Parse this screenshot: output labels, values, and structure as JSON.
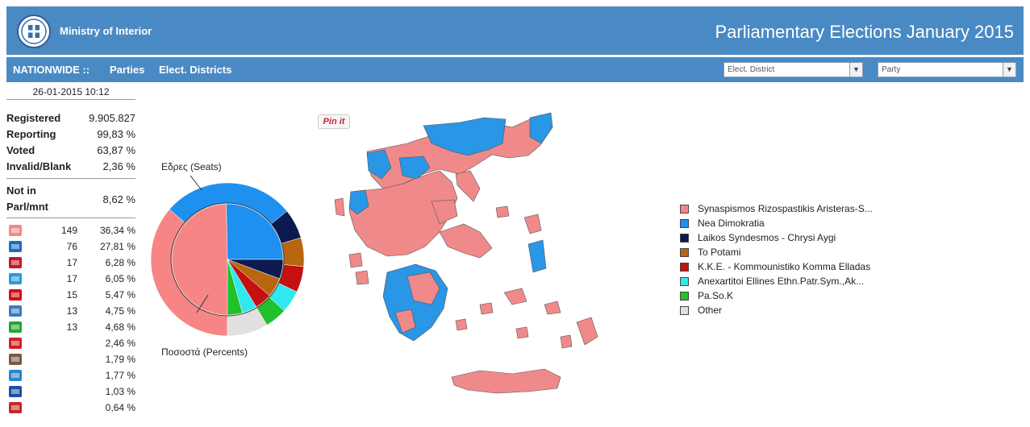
{
  "header": {
    "ministry": "Ministry of Interior",
    "title": "Parliamentary Elections January 2015",
    "logo_icon": "greek-emblem-icon"
  },
  "nav": {
    "nationwide": "NATIONWIDE ::",
    "parties": "Parties",
    "districts": "Elect. Districts",
    "district_select": "Elect. District",
    "party_select": "Party"
  },
  "stats": {
    "datetime": "26-01-2015 10:12",
    "registered_label": "Registered",
    "registered": "9.905.827",
    "reporting_label": "Reporting",
    "reporting": "99,83 %",
    "voted_label": "Voted",
    "voted": "63,87 %",
    "invalid_label": "Invalid/Blank",
    "invalid": "2,36 %",
    "notin_label": "Not in Parl/mnt",
    "notin": "8,62 %"
  },
  "parties": [
    {
      "icon": "syriza-logo-icon",
      "seats": "149",
      "pct": "36,34 %",
      "color": "#f08a8a"
    },
    {
      "icon": "nd-logo-icon",
      "seats": "76",
      "pct": "27,81 %",
      "color": "#1c6fb8"
    },
    {
      "icon": "golden-dawn-logo-icon",
      "seats": "17",
      "pct": "6,28 %",
      "color": "#c0182a"
    },
    {
      "icon": "potami-logo-icon",
      "seats": "17",
      "pct": "6,05 %",
      "color": "#2b9ad6"
    },
    {
      "icon": "kke-logo-icon",
      "seats": "15",
      "pct": "5,47 %",
      "color": "#d1121b"
    },
    {
      "icon": "anel-logo-icon",
      "seats": "13",
      "pct": "4,75 %",
      "color": "#3a7cc7"
    },
    {
      "icon": "pasok-logo-icon",
      "seats": "13",
      "pct": "4,68 %",
      "color": "#27a535"
    },
    {
      "icon": "kidiso-logo-icon",
      "seats": "",
      "pct": "2,46 %",
      "color": "#d42025"
    },
    {
      "icon": "leader-portrait-icon",
      "seats": "",
      "pct": "1,79 %",
      "color": "#7a5a45"
    },
    {
      "icon": "teleia-logo-icon",
      "seats": "",
      "pct": "1,77 %",
      "color": "#2b86c8"
    },
    {
      "icon": "anarsya-logo-icon",
      "seats": "",
      "pct": "1,03 %",
      "color": "#1f4fa0"
    },
    {
      "icon": "party-map-logo-icon",
      "seats": "",
      "pct": "0,64 %",
      "color": "#c62828"
    }
  ],
  "pinit": "Pin it",
  "chart_data": {
    "type": "pie",
    "seats_label": "Εδρες (Seats)",
    "percents_label": "Ποσοστά (Percents)",
    "categories": [
      "Synaspismos Rizospastikis Aristeras-S...",
      "Nea Dimokratia",
      "Laikos Syndesmos - Chrysi Aygi",
      "To Potami",
      "K.K.E. - Kommounistiko Komma Elladas",
      "Anexartitoi Ellines Ethn.Patr.Sym.,Ak...",
      "Pa.So.K",
      "Other"
    ],
    "colors": [
      "#f88585",
      "#1e90f0",
      "#0b1a4f",
      "#b8660f",
      "#c41010",
      "#30e8f0",
      "#22c02a",
      "#e0e0e0"
    ],
    "seats": [
      149,
      76,
      17,
      17,
      15,
      13,
      13,
      0
    ],
    "percents": [
      36.34,
      27.81,
      6.28,
      6.05,
      5.47,
      4.75,
      4.68,
      8.62
    ]
  },
  "legend": [
    {
      "label": "Synaspismos Rizospastikis Aristeras-S...",
      "color": "#f88585"
    },
    {
      "label": "Nea Dimokratia",
      "color": "#1e90f0"
    },
    {
      "label": "Laikos Syndesmos - Chrysi Aygi",
      "color": "#0b1a4f"
    },
    {
      "label": "To Potami",
      "color": "#b8660f"
    },
    {
      "label": "K.K.E. - Kommounistiko Komma Elladas",
      "color": "#c41010"
    },
    {
      "label": "Anexartitoi Ellines Ethn.Patr.Sym.,Ak...",
      "color": "#30e8f0"
    },
    {
      "label": "Pa.So.K",
      "color": "#22c02a"
    },
    {
      "label": "Other",
      "color": "#e0e0e0"
    }
  ],
  "map": {
    "icon": "greece-results-map-icon",
    "color_syriza": "#f08a8a",
    "color_nd": "#2a96e6"
  }
}
